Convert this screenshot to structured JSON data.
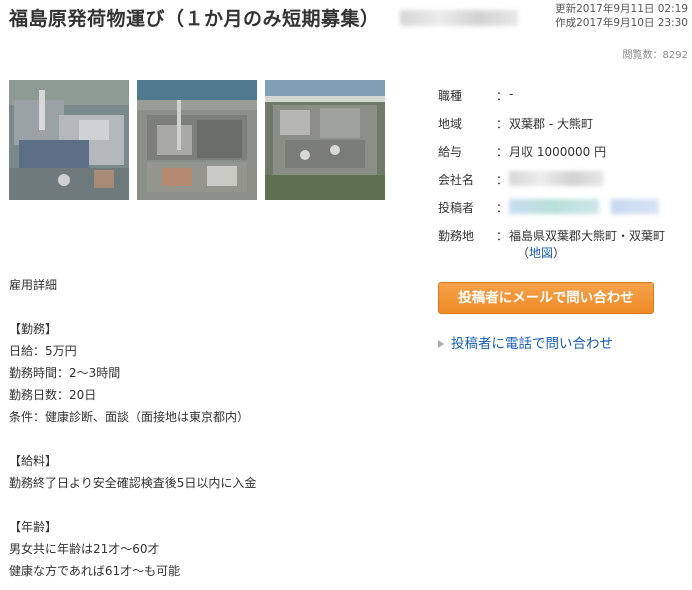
{
  "header": {
    "title": "福島原発荷物運び（１か月のみ短期募集）",
    "updated": "更新2017年9月11日 02:19",
    "created": "作成2017年9月10日 23:30",
    "views": "閲覧数：8292"
  },
  "info": {
    "job_type_label": "職種",
    "job_type_value": "-",
    "area_label": "地域",
    "area_value": "双葉郡 - 大熊町",
    "salary_label": "給与",
    "salary_value": "月収 1000000 円",
    "company_label": "会社名",
    "poster_label": "投稿者",
    "location_label": "勤務地",
    "location_value": "福島県双葉郡大熊町・双葉町",
    "map_open": "（",
    "map_link": "地図",
    "map_close": "）",
    "colon": "："
  },
  "actions": {
    "mail_button": "投稿者にメールで問い合わせ",
    "tel_link": "投稿者に電話で問い合わせ"
  },
  "details": {
    "heading": "雇用詳細",
    "work_heading": "【勤務】",
    "daily_pay": "日給：5万円",
    "hours": "勤務時間：2〜3時間",
    "days": "勤務日数：20日",
    "conditions": "条件：健康診断、面談（面接地は東京都内）",
    "pay_heading": "【給料】",
    "pay_text": "勤務終了日より安全確認検査後5日以内に入金",
    "age_heading": "【年齢】",
    "age_text1": "男女共に年齢は21才〜60才",
    "age_text2": "健康な方であれば61才〜も可能"
  },
  "colors": {
    "accent_orange": "#ee8a24",
    "link_blue": "#1a5fb4"
  },
  "icons": [
    "triangle-right-icon"
  ]
}
